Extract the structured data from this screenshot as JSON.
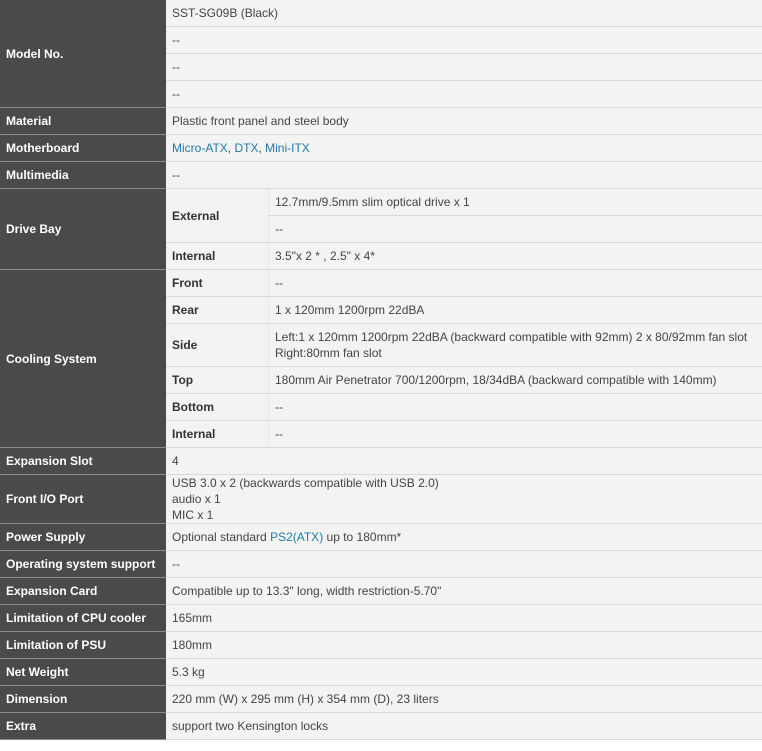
{
  "model_no": {
    "label": "Model No.",
    "values": [
      "SST-SG09B (Black)",
      "--",
      "--",
      "--"
    ]
  },
  "material": {
    "label": "Material",
    "value": "Plastic front panel and steel body"
  },
  "motherboard": {
    "label": "Motherboard",
    "links": [
      "Micro-ATX",
      "DTX",
      "Mini-ITX"
    ],
    "sep": ", "
  },
  "multimedia": {
    "label": "Multimedia",
    "value": "--"
  },
  "drive_bay": {
    "label": "Drive Bay",
    "external_label": "External",
    "external_values": [
      "12.7mm/9.5mm slim optical drive x 1",
      "--"
    ],
    "internal_label": "Internal",
    "internal_value": "3.5\"x 2 * , 2.5\" x 4*"
  },
  "cooling": {
    "label": "Cooling System",
    "front_label": "Front",
    "front_value": "--",
    "rear_label": "Rear",
    "rear_value": "1 x 120mm 1200rpm 22dBA",
    "side_label": "Side",
    "side_line1": "Left:1 x 120mm 1200rpm 22dBA (backward compatible with 92mm) 2 x 80/92mm fan slot",
    "side_line2": "Right:80mm fan slot",
    "top_label": "Top",
    "top_value": "180mm Air Penetrator 700/1200rpm, 18/34dBA (backward compatible with 140mm)",
    "bottom_label": "Bottom",
    "bottom_value": "--",
    "internal_label": "Internal",
    "internal_value": "--"
  },
  "expansion_slot": {
    "label": "Expansion Slot",
    "value": "4"
  },
  "front_io": {
    "label": "Front I/O Port",
    "line1": "USB 3.0 x 2 (backwards compatible with USB 2.0)",
    "line2": "audio x 1",
    "line3": "MIC x 1"
  },
  "power_supply": {
    "label": "Power Supply",
    "prefix": "Optional standard ",
    "link": "PS2(ATX)",
    "suffix": " up to 180mm*"
  },
  "os_support": {
    "label": "Operating system support",
    "value": "--"
  },
  "expansion_card": {
    "label": "Expansion Card",
    "value": "Compatible up to 13.3\" long, width restriction-5.70\""
  },
  "cpu_cooler": {
    "label": "Limitation of CPU cooler",
    "value": "165mm"
  },
  "psu_limit": {
    "label": "Limitation of PSU",
    "value": "180mm"
  },
  "net_weight": {
    "label": "Net Weight",
    "value": "5.3 kg"
  },
  "dimension": {
    "label": "Dimension",
    "value": "220 mm (W) x 295 mm (H) x 354 mm (D), 23 liters"
  },
  "extra": {
    "label": "Extra",
    "value": "support two Kensington locks"
  },
  "colors": {
    "header_bg": "#4a4a4a",
    "cell_bg": "#f3f3f3",
    "link": "#1f7aa6"
  }
}
